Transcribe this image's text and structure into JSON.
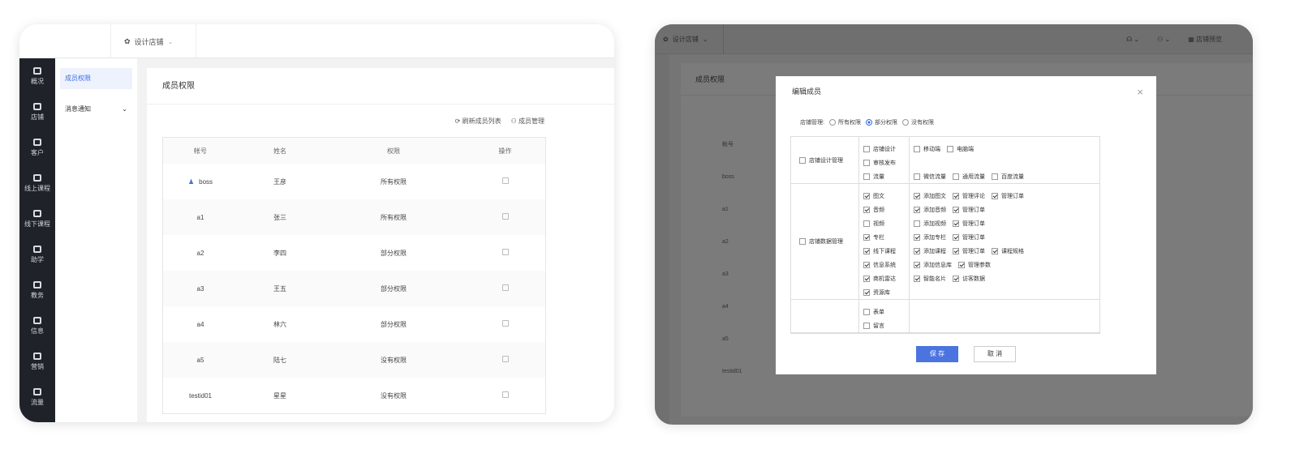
{
  "left": {
    "shop_selector": "设计店铺",
    "sidebar": [
      "概况",
      "店铺",
      "客户",
      "线上课程",
      "线下课程",
      "助学",
      "教务",
      "信息",
      "营销",
      "流量"
    ],
    "subnav": [
      {
        "label": "成员权限",
        "active": true
      },
      {
        "label": "消息通知",
        "active": false
      }
    ],
    "content_title": "成员权限",
    "actions": {
      "refresh": "刷新成员列表",
      "manage": "成员管理"
    },
    "table": {
      "headers": [
        "帐号",
        "姓名",
        "权限",
        "操作"
      ],
      "rows": [
        {
          "account": "boss",
          "name": "王彦",
          "permission": "所有权限",
          "owner": true
        },
        {
          "account": "a1",
          "name": "张三",
          "permission": "所有权限"
        },
        {
          "account": "a2",
          "name": "李四",
          "permission": "部分权限"
        },
        {
          "account": "a3",
          "name": "王五",
          "permission": "部分权限"
        },
        {
          "account": "a4",
          "name": "林六",
          "permission": "部分权限"
        },
        {
          "account": "a5",
          "name": "陆七",
          "permission": "没有权限"
        },
        {
          "account": "testid01",
          "name": "星星",
          "permission": "没有权限"
        }
      ]
    }
  },
  "right": {
    "shop_selector": "设计店铺",
    "topbar": {
      "preview": "店铺预览"
    },
    "content_title": "成员权限",
    "table_header": "帐号",
    "accounts": [
      "boss",
      "a1",
      "a2",
      "a3",
      "a4",
      "a5",
      "testid01"
    ],
    "modal": {
      "title": "编辑成员",
      "shop_manage_label": "店铺管理:",
      "radios": [
        {
          "label": "所有权限",
          "on": false
        },
        {
          "label": "部分权限",
          "on": true
        },
        {
          "label": "没有权限",
          "on": false
        }
      ],
      "sections": [
        {
          "name": "店铺设计管理",
          "rows": [
            {
              "perm": {
                "label": "店铺设计",
                "on": false
              },
              "subs": [
                {
                  "label": "移动端",
                  "on": false
                },
                {
                  "label": "电脑端",
                  "on": false
                }
              ]
            },
            {
              "perm": {
                "label": "审核发布",
                "on": false
              },
              "subs": []
            },
            {
              "perm": {
                "label": "流量",
                "on": false
              },
              "subs": [
                {
                  "label": "微信流量",
                  "on": false
                },
                {
                  "label": "通用流量",
                  "on": false
                },
                {
                  "label": "百度流量",
                  "on": false
                }
              ]
            }
          ]
        },
        {
          "name": "店铺数据管理",
          "rows": [
            {
              "perm": {
                "label": "图文",
                "on": true
              },
              "subs": [
                {
                  "label": "添加图文",
                  "on": true
                },
                {
                  "label": "管理评论",
                  "on": true
                },
                {
                  "label": "管理订单",
                  "on": true
                }
              ]
            },
            {
              "perm": {
                "label": "音频",
                "on": true
              },
              "subs": [
                {
                  "label": "添加音频",
                  "on": true
                },
                {
                  "label": "管理订单",
                  "on": true
                }
              ]
            },
            {
              "perm": {
                "label": "视频",
                "on": false
              },
              "subs": [
                {
                  "label": "添加视频",
                  "on": false
                },
                {
                  "label": "管理订单",
                  "on": true
                }
              ]
            },
            {
              "perm": {
                "label": "专栏",
                "on": true
              },
              "subs": [
                {
                  "label": "添加专栏",
                  "on": true
                },
                {
                  "label": "管理订单",
                  "on": true
                }
              ]
            },
            {
              "perm": {
                "label": "线下课程",
                "on": true
              },
              "subs": [
                {
                  "label": "添加课程",
                  "on": true
                },
                {
                  "label": "管理订单",
                  "on": true
                },
                {
                  "label": "课程规格",
                  "on": true
                }
              ]
            },
            {
              "perm": {
                "label": "信息系统",
                "on": true
              },
              "subs": [
                {
                  "label": "添加信息库",
                  "on": true
                },
                {
                  "label": "管理参数",
                  "on": true
                }
              ]
            },
            {
              "perm": {
                "label": "商机雷达",
                "on": true
              },
              "subs": [
                {
                  "label": "智能名片",
                  "on": true
                },
                {
                  "label": "访客数据",
                  "on": true
                }
              ]
            },
            {
              "perm": {
                "label": "资源库",
                "on": true
              },
              "subs": []
            }
          ]
        },
        {
          "name": "",
          "rows": [
            {
              "perm": {
                "label": "表单",
                "on": false
              },
              "subs": []
            },
            {
              "perm": {
                "label": "留言",
                "on": false
              },
              "subs": []
            }
          ]
        }
      ],
      "save": "保 存",
      "cancel": "取 消"
    }
  }
}
